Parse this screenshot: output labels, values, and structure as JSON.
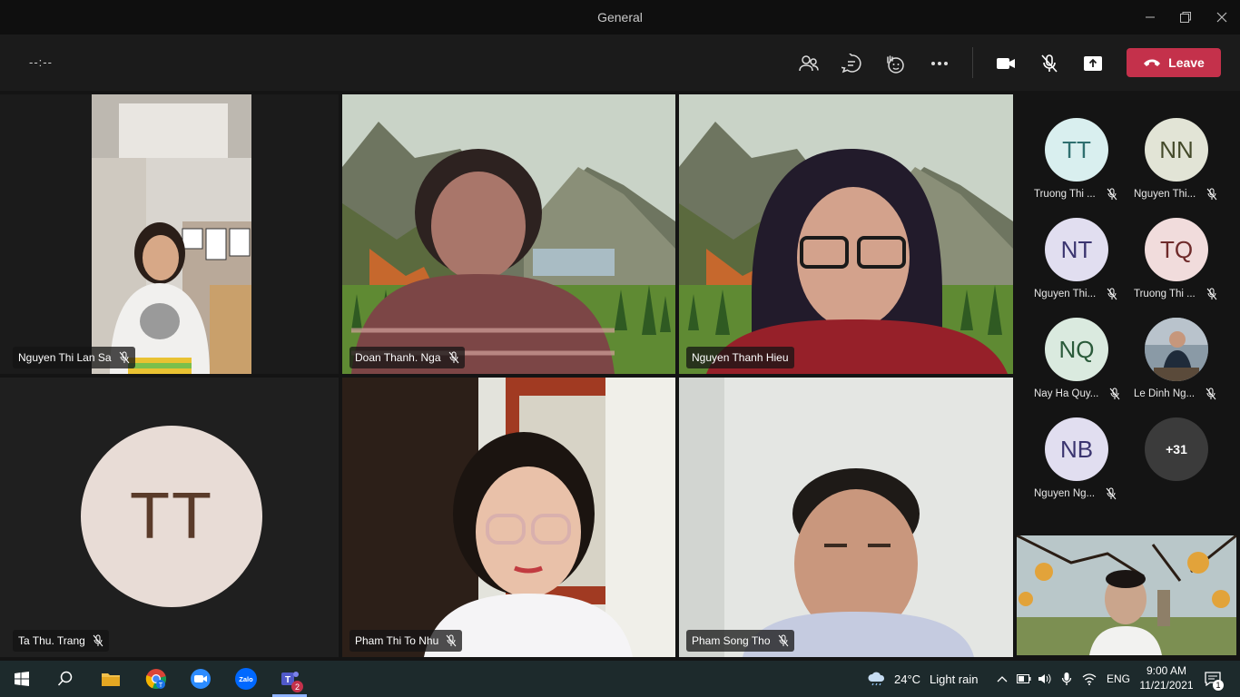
{
  "window": {
    "title": "General"
  },
  "toolbar": {
    "timer": "--:--",
    "leave_label": "Leave"
  },
  "tiles": [
    {
      "name": "Nguyen Thi Lan Sa",
      "muted": true
    },
    {
      "name": "Doan Thanh. Nga",
      "muted": true
    },
    {
      "name": "Nguyen Thanh Hieu",
      "muted": false
    },
    {
      "name": "Ta Thu. Trang",
      "muted": true,
      "initials": "TT"
    },
    {
      "name": "Pham Thi To Nhu",
      "muted": true
    },
    {
      "name": "Pham Song Tho",
      "muted": true
    }
  ],
  "roster": [
    {
      "initials": "TT",
      "label": "Truong Thi ...",
      "bg": "#d9efef",
      "fg": "#2f6f6f"
    },
    {
      "initials": "NN",
      "label": "Nguyen Thi...",
      "bg": "#e2e4d6",
      "fg": "#444a2a"
    },
    {
      "initials": "NT",
      "label": "Nguyen Thi...",
      "bg": "#e1def0",
      "fg": "#3b3570"
    },
    {
      "initials": "TQ",
      "label": "Truong Thi ...",
      "bg": "#f1dcdc",
      "fg": "#6e2a2a"
    },
    {
      "initials": "NQ",
      "label": "Nay Ha Quy...",
      "bg": "#daeadf",
      "fg": "#2a5a3a"
    },
    {
      "initials": "",
      "label": "Le Dinh Ng...",
      "bg": "#6a7a88",
      "fg": "#fff"
    },
    {
      "initials": "NB",
      "label": "Nguyen Ng...",
      "bg": "#e1def0",
      "fg": "#3b3570"
    },
    {
      "initials": "+31",
      "label": "",
      "bg": "#3b3b3b",
      "fg": "#fff"
    }
  ],
  "taskbar": {
    "weather_temp": "24°C",
    "weather_desc": "Light rain",
    "lang": "ENG",
    "time": "9:00 AM",
    "date": "11/21/2021",
    "teams_badge": "2",
    "notif_count": "1",
    "zalo_label": "Zalo"
  },
  "colors": {
    "leave": "#c4314b",
    "toolbar": "#1b1b1b",
    "taskbar": "#1d2a2c"
  }
}
